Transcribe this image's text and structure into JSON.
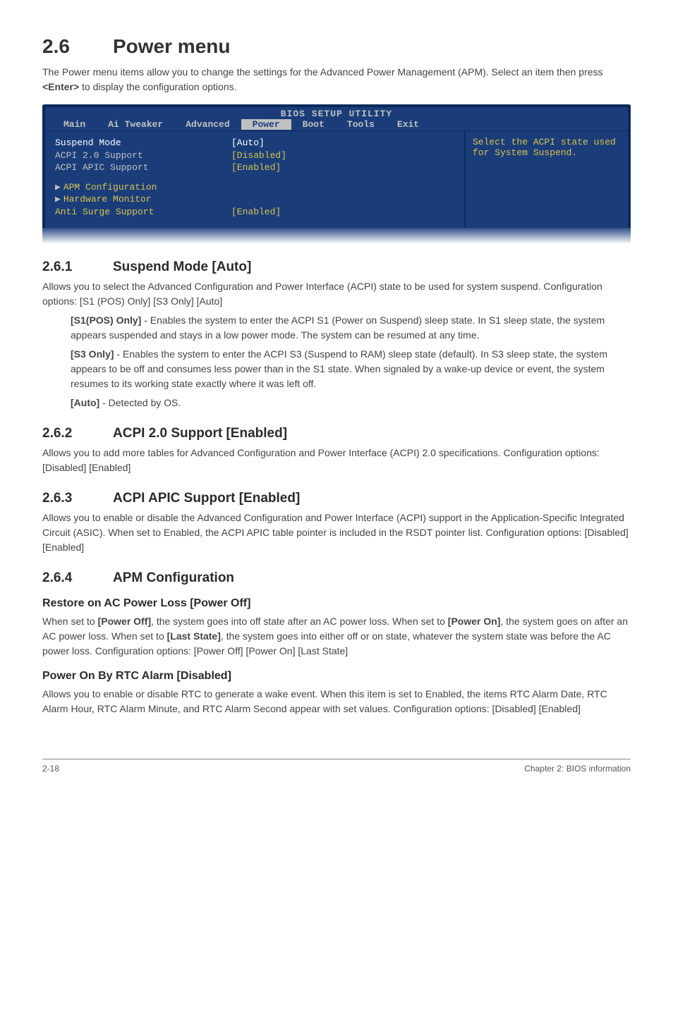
{
  "header": {
    "section_number": "2.6",
    "section_title": "Power menu"
  },
  "intro": {
    "text_before": "The Power menu items allow you to change the settings for the Advanced Power Management (APM). Select an item then press ",
    "key": "<Enter>",
    "text_after": " to display the configuration options."
  },
  "bios": {
    "title": "BIOS SETUP UTILITY",
    "tabs": [
      "Main",
      "Ai Tweaker",
      "Advanced",
      "Power",
      "Boot",
      "Tools",
      "Exit"
    ],
    "active_tab": "Power",
    "left_items": [
      {
        "label": "Suspend Mode",
        "value": "[Auto]",
        "selected": true
      },
      {
        "label": "ACPI 2.0 Support",
        "value": "[Disabled]"
      },
      {
        "label": "ACPI APIC Support",
        "value": "[Enabled]"
      }
    ],
    "sub_items": [
      {
        "label": "APM Configuration"
      },
      {
        "label": "Hardware Monitor"
      }
    ],
    "after_sub": {
      "label": "Anti Surge Support",
      "value": "[Enabled]"
    },
    "help": "Select the ACPI state used for System Suspend."
  },
  "s261": {
    "num": "2.6.1",
    "title": "Suspend Mode [Auto]",
    "intro": "Allows you to select the Advanced Configuration and Power Interface (ACPI) state to be used for system suspend. Configuration options: [S1 (POS) Only] [S3 Only] [Auto]",
    "opts": [
      {
        "bold": "[S1(POS) Only]",
        "text": " - Enables the system to enter the ACPI S1 (Power on Suspend) sleep state. In S1 sleep state, the system appears suspended and stays in a low power mode. The system can be resumed at any time."
      },
      {
        "bold": "[S3 Only]",
        "text": " - Enables the system to enter the ACPI S3 (Suspend to RAM) sleep state (default). In S3 sleep state, the system appears to be off and consumes less power than in the S1 state. When signaled by a wake-up device or event, the system resumes to its working state exactly where it was left off."
      },
      {
        "bold": "[Auto]",
        "text": " - Detected by OS."
      }
    ]
  },
  "s262": {
    "num": "2.6.2",
    "title": "ACPI 2.0 Support [Enabled]",
    "body": "Allows you to add more tables for Advanced Configuration and Power Interface (ACPI) 2.0 specifications. Configuration options: [Disabled] [Enabled]"
  },
  "s263": {
    "num": "2.6.3",
    "title": "ACPI APIC Support [Enabled]",
    "body": "Allows you to enable or disable the Advanced Configuration and Power Interface (ACPI) support in the Application-Specific Integrated Circuit (ASIC). When set to Enabled, the ACPI APIC table pointer is included in the RSDT pointer list. Configuration options: [Disabled] [Enabled]"
  },
  "s264": {
    "num": "2.6.4",
    "title": "APM Configuration",
    "items": [
      {
        "heading": "Restore on AC Power Loss [Power Off]",
        "pre1": "When set to ",
        "b1": "[Power Off]",
        "mid1": ", the system goes into off state after an AC power loss. When set to ",
        "b2": "[Power On]",
        "mid2": ", the system goes on after an AC power loss. When set to ",
        "b3": "[Last State]",
        "post": ", the system goes into either off or on state, whatever the system state was before the AC power loss. Configuration options: [Power Off] [Power On] [Last State]"
      },
      {
        "heading": "Power On By RTC Alarm [Disabled]",
        "body": "Allows you to enable or disable RTC to generate a wake event. When this item is set to Enabled, the items RTC Alarm Date, RTC Alarm Hour, RTC Alarm Minute, and RTC Alarm Second appear with set values. Configuration options: [Disabled] [Enabled]"
      }
    ]
  },
  "footer": {
    "left": "2-18",
    "right": "Chapter 2: BIOS information"
  }
}
